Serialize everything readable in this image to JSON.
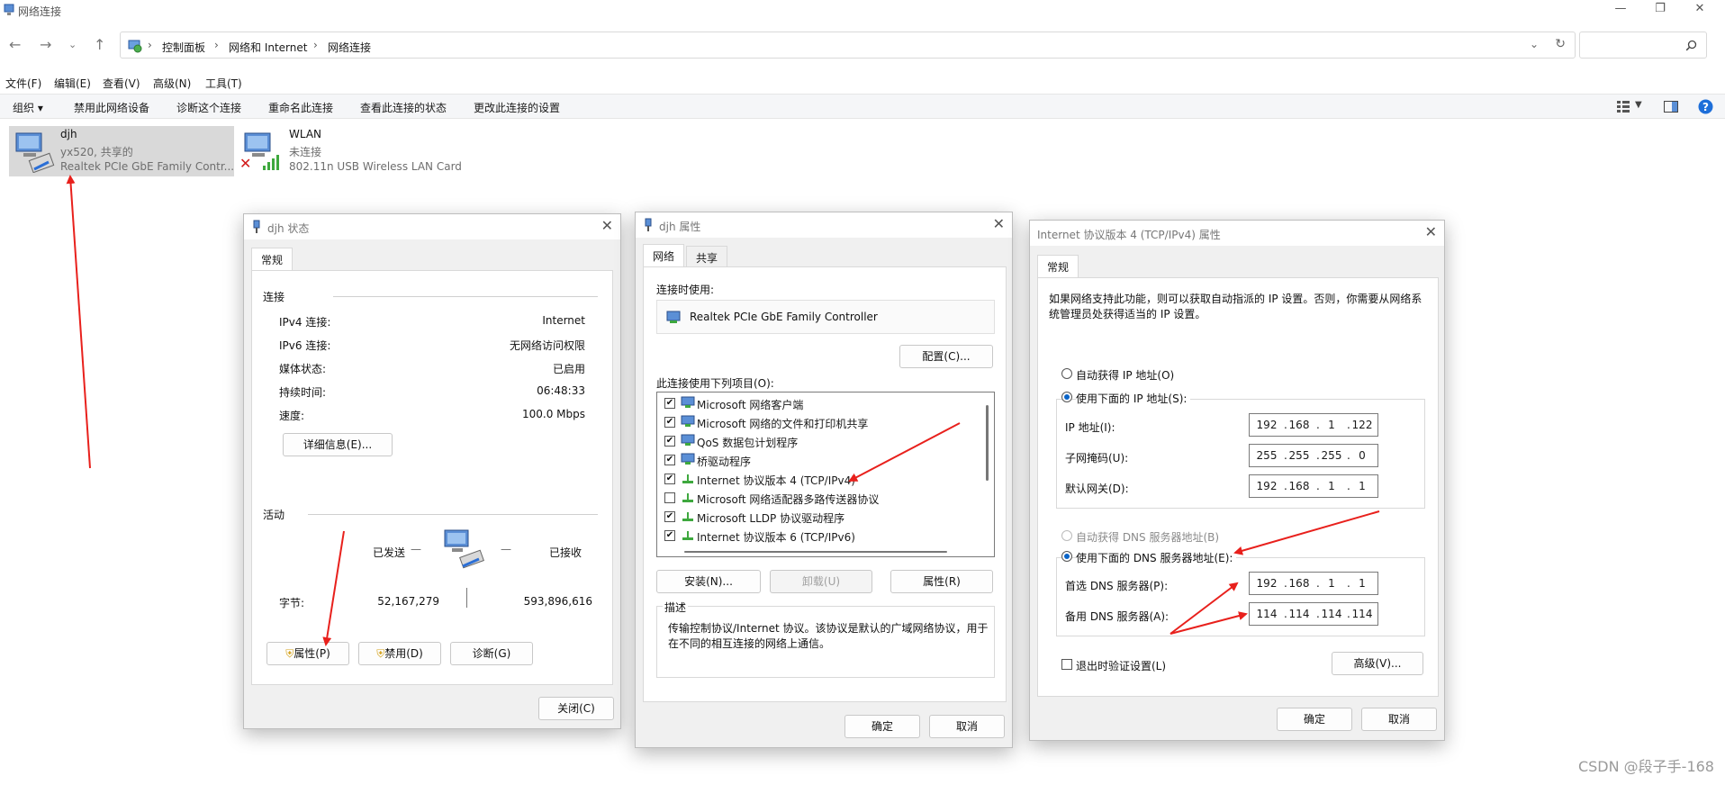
{
  "window": {
    "title": "网络连接"
  },
  "nav": {
    "breadcrumb": [
      "控制面板",
      "网络和 Internet",
      "网络连接"
    ],
    "search_placeholder": ""
  },
  "menu": [
    "文件(F)",
    "编辑(E)",
    "查看(V)",
    "高级(N)",
    "工具(T)"
  ],
  "commands": [
    "组织 ▾",
    "禁用此网络设备",
    "诊断这个连接",
    "重命名此连接",
    "查看此连接的状态",
    "更改此连接的设置"
  ],
  "adapters": [
    {
      "name": "djh",
      "status": "yx520, 共享的",
      "device": "Realtek PCIe GbE Family Contr..."
    },
    {
      "name": "WLAN",
      "status": "未连接",
      "device": "802.11n USB Wireless LAN Card"
    }
  ],
  "status_dialog": {
    "title": "djh 状态",
    "tab": "常规",
    "connection_header": "连接",
    "rows": [
      {
        "label": "IPv4 连接:",
        "value": "Internet"
      },
      {
        "label": "IPv6 连接:",
        "value": "无网络访问权限"
      },
      {
        "label": "媒体状态:",
        "value": "已启用"
      },
      {
        "label": "持续时间:",
        "value": "06:48:33"
      },
      {
        "label": "速度:",
        "value": "100.0 Mbps"
      }
    ],
    "details_button": "详细信息(E)...",
    "activity_header": "活动",
    "sent_label": "已发送",
    "recv_label": "已接收",
    "bytes_label": "字节:",
    "bytes_sent": "52,167,279",
    "bytes_recv": "593,896,616",
    "properties_button": "属性(P)",
    "disable_button": "禁用(D)",
    "diagnose_button": "诊断(G)",
    "close_button": "关闭(C)"
  },
  "props_dialog": {
    "title": "djh 属性",
    "tabs": [
      "网络",
      "共享"
    ],
    "connect_using_label": "连接时使用:",
    "adapter_name": "Realtek PCIe GbE Family Controller",
    "configure_button": "配置(C)...",
    "items_label": "此连接使用下列项目(O):",
    "items": [
      {
        "label": "Microsoft 网络客户端",
        "checked": "✔"
      },
      {
        "label": "Microsoft 网络的文件和打印机共享",
        "checked": "✔"
      },
      {
        "label": "QoS 数据包计划程序",
        "checked": "✔"
      },
      {
        "label": "桥驱动程序",
        "checked": "✔"
      },
      {
        "label": "Internet 协议版本 4 (TCP/IPv4)",
        "checked": "✔"
      },
      {
        "label": "Microsoft 网络适配器多路传送器协议",
        "checked": ""
      },
      {
        "label": "Microsoft LLDP 协议驱动程序",
        "checked": "✔"
      },
      {
        "label": "Internet 协议版本 6 (TCP/IPv6)",
        "checked": "✔"
      }
    ],
    "install_button": "安装(N)...",
    "uninstall_button": "卸载(U)",
    "properties_button": "属性(R)",
    "description_header": "描述",
    "description": "传输控制协议/Internet 协议。该协议是默认的广域网络协议，用于在不同的相互连接的网络上通信。",
    "ok_button": "确定",
    "cancel_button": "取消"
  },
  "ipv4_dialog": {
    "title": "Internet 协议版本 4 (TCP/IPv4) 属性",
    "tab": "常规",
    "intro": "如果网络支持此功能，则可以获取自动指派的 IP 设置。否则，你需要从网络系统管理员处获得适当的 IP 设置。",
    "auto_ip": "自动获得 IP 地址(O)",
    "manual_ip": "使用下面的 IP 地址(S):",
    "ip_label": "IP 地址(I):",
    "ip": [
      "192",
      "168",
      "1",
      "122"
    ],
    "mask_label": "子网掩码(U):",
    "mask": [
      "255",
      "255",
      "255",
      "0"
    ],
    "gateway_label": "默认网关(D):",
    "gateway": [
      "192",
      "168",
      "1",
      "1"
    ],
    "auto_dns": "自动获得 DNS 服务器地址(B)",
    "manual_dns": "使用下面的 DNS 服务器地址(E):",
    "dns1_label": "首选 DNS 服务器(P):",
    "dns1": [
      "192",
      "168",
      "1",
      "1"
    ],
    "dns2_label": "备用 DNS 服务器(A):",
    "dns2": [
      "114",
      "114",
      "114",
      "114"
    ],
    "validate_label": "退出时验证设置(L)",
    "advanced_button": "高级(V)...",
    "ok_button": "确定",
    "cancel_button": "取消"
  },
  "watermark": "CSDN @段子手-168",
  "colors": {
    "accent": "#0a64c8",
    "annotation": "#e8201c",
    "selection": "#d9d9d9"
  }
}
